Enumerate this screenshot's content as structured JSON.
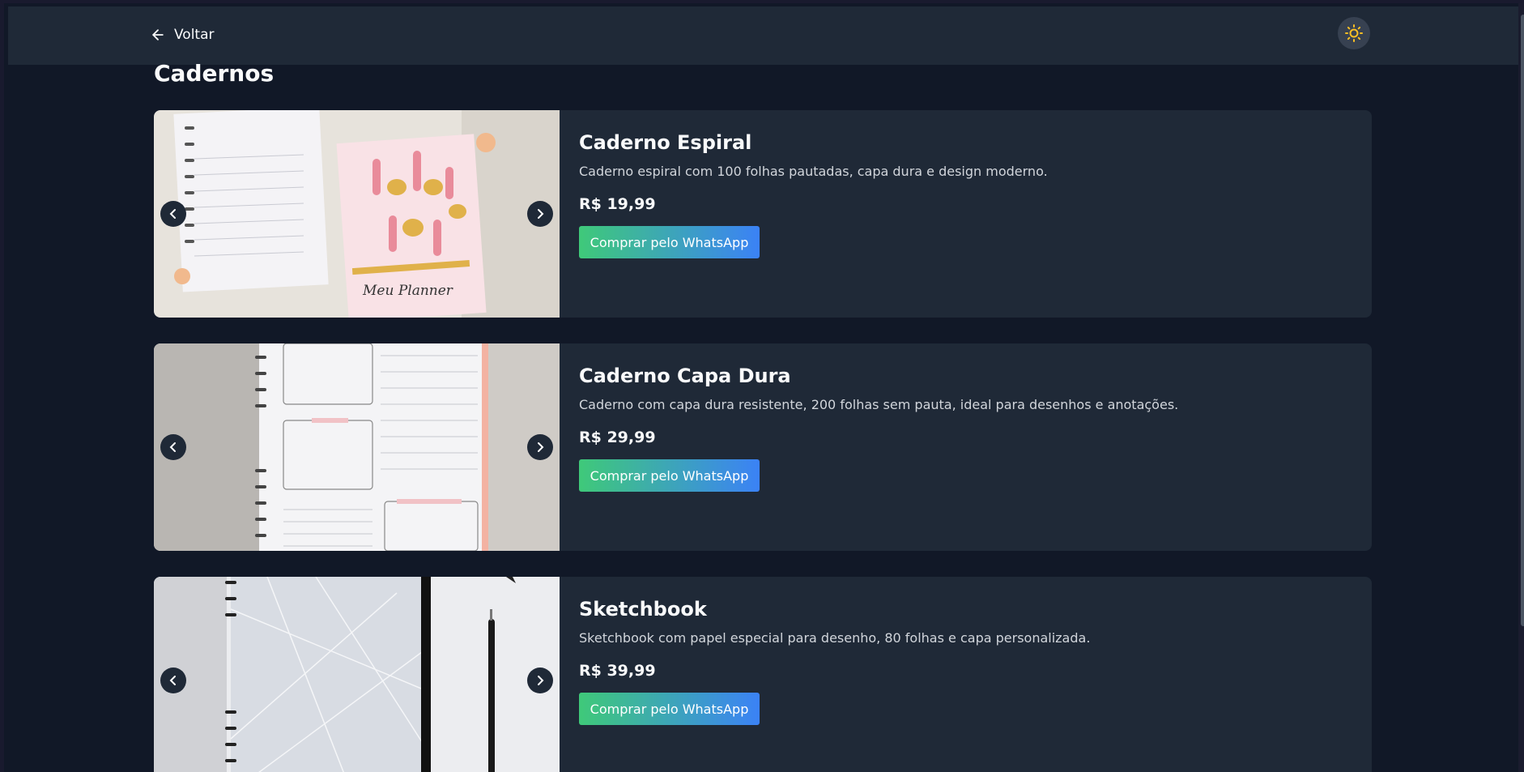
{
  "header": {
    "back_label": "Voltar",
    "theme_icon": "sun-icon",
    "accent": "#fbbf24"
  },
  "page": {
    "title": "Cadernos"
  },
  "products": [
    {
      "name": "Caderno Espiral",
      "description": "Caderno espiral com 100 folhas pautadas, capa dura e design moderno.",
      "price": "R$ 19,99",
      "button_label": "Comprar pelo WhatsApp",
      "image_caption": "Meu Planner"
    },
    {
      "name": "Caderno Capa Dura",
      "description": "Caderno com capa dura resistente, 200 folhas sem pauta, ideal para desenhos e anotações.",
      "price": "R$ 29,99",
      "button_label": "Comprar pelo WhatsApp"
    },
    {
      "name": "Sketchbook",
      "description": "Sketchbook com papel especial para desenho, 80 folhas e capa personalizada.",
      "price": "R$ 39,99",
      "button_label": "Comprar pelo WhatsApp"
    }
  ],
  "colors": {
    "button_gradient_start": "#3fc979",
    "button_gradient_end": "#3b82f6",
    "card_bg": "#1f2937",
    "page_bg": "#111827"
  }
}
